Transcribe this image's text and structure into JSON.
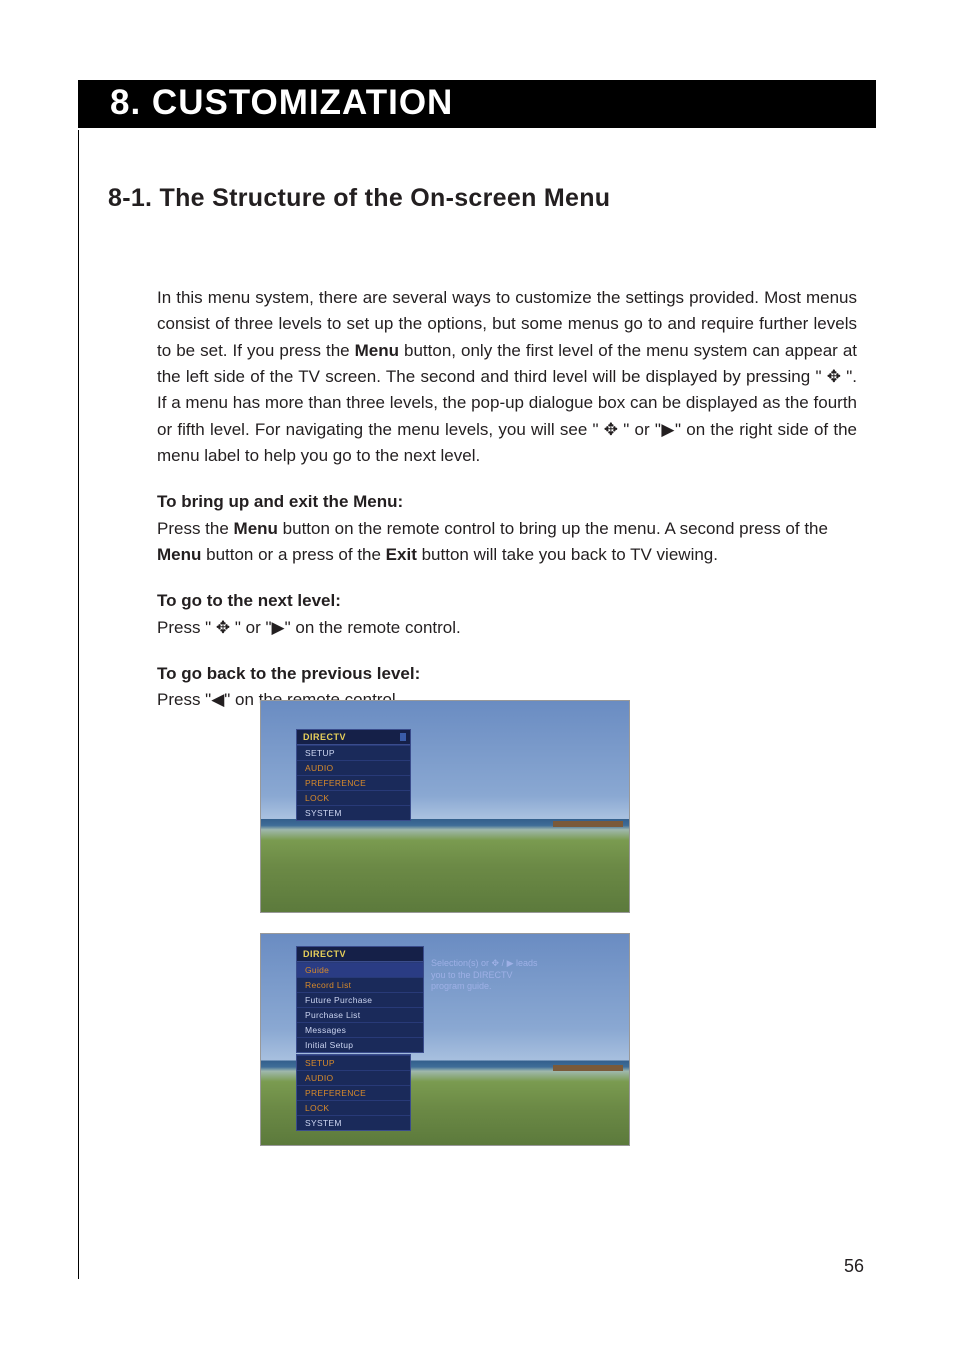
{
  "chapter": {
    "title": "8. CUSTOMIZATION"
  },
  "section": {
    "heading": "8-1. The Structure of the On-screen Menu"
  },
  "intro": {
    "p1_a": "In this menu system, there are several ways to customize the settings provided.  Most menus consist of three levels to set up the options, but some menus go to and require further levels to be set.  If you press the ",
    "p1_b_bold": "Menu",
    "p1_c": " button, only the first level of the menu system can appear at the left side of the TV screen.  The second and third level will be displayed by pressing \" ✥ \".  If a menu has more than three levels, the pop-up dialogue box can be displayed as the fourth or fifth level.  For navigating the menu levels, you will see \" ✥ \" or \"▶\" on the right side of the menu label to help you go to the next level."
  },
  "sub1": {
    "head": "To bring up and exit the Menu:",
    "a": "Press the ",
    "menu1": "Menu",
    "b": " button on the remote control to bring up the menu.  A second press of the ",
    "menu2": "Menu",
    "c": " button or a press of the ",
    "exit": "Exit",
    "d": " button will take you back to TV viewing."
  },
  "sub2": {
    "head": "To go to the next level:",
    "line": "Press \" ✥ \" or \"▶\" on the remote control."
  },
  "sub3": {
    "head": "To go back to the previous level:",
    "line": "Press \"◀\" on the remote control."
  },
  "fig1_menu": {
    "header": "DIRECTV",
    "items": [
      "SETUP",
      "AUDIO",
      "PREFERENCE",
      "LOCK",
      "SYSTEM"
    ]
  },
  "fig2_top": {
    "header": "DIRECTV",
    "items": [
      "Guide",
      "Record List",
      "Future Purchase",
      "Purchase List",
      "Messages",
      "Initial Setup"
    ]
  },
  "fig2_bottom": {
    "items": [
      "SETUP",
      "AUDIO",
      "PREFERENCE",
      "LOCK",
      "SYSTEM"
    ]
  },
  "fig2_info": {
    "l1": "Selection(s) or ✥ / ▶ leads",
    "l2": "you to the DIRECTV",
    "l3": "program guide."
  },
  "page_number": "56"
}
